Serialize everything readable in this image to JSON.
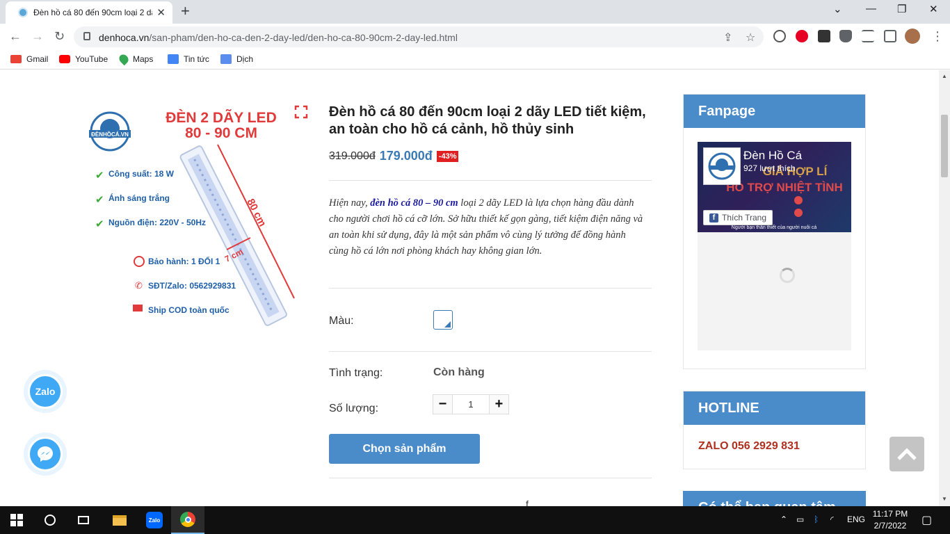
{
  "browser": {
    "tab_title": "Đèn hồ cá 80 đến 90cm loại 2 dã",
    "url_domain": "denhoca.vn",
    "url_path": "/san-pham/den-ho-ca-den-2-day-led/den-ho-ca-80-90cm-2-day-led.html",
    "bookmarks": [
      "Gmail",
      "YouTube",
      "Maps",
      "Tin tức",
      "Dịch"
    ]
  },
  "product": {
    "image_text": {
      "logo": "ĐÈNHỒCÁ.VN",
      "heading_1": "ĐÈN 2 DÃY LED",
      "heading_2": "80 - 90 CM",
      "feature_1": "Công suất: 18 W",
      "feature_2": "Ánh sáng trắng",
      "feature_3": "Nguồn điện: 220V - 50Hz",
      "length": "80 cm",
      "width": "7 cm",
      "warranty": "Bảo hành: 1 ĐỔI 1",
      "phone": "SĐT/Zalo: 0562929831",
      "ship": "Ship COD toàn quốc"
    },
    "title": "Đèn hồ cá 80 đến 90cm loại 2 dãy LED tiết kiệm, an toàn cho hồ cá cảnh, hồ thủy sinh",
    "old_price": "319.000đ",
    "new_price": "179.000đ",
    "discount": "-43%",
    "desc_before": "Hiện nay, ",
    "desc_highlight": "đèn hồ cá 80 – 90 cm",
    "desc_after": " loại 2 dãy LED là lựa chọn hàng đầu dành cho người chơi hồ cá cỡ lớn. Sở hữu thiết kế gọn gàng, tiết kiệm điện năng và an toàn khi sử dụng, đây là một sản phẩm vô cùng lý tưởng để đồng hành cùng hồ cá lớn nơi phòng khách hay không gian lớn.",
    "color_label": "Màu:",
    "status_label": "Tình trạng:",
    "status_value": "Còn hàng",
    "qty_label": "Số lượng:",
    "qty_value": "1",
    "buy_label": "Chọn sản phẩm",
    "tail_glyph": "f"
  },
  "sidebar": {
    "fanpage_title": "Fanpage",
    "fb_page_name": "Đèn Hồ Cá",
    "fb_likes": "927 lượt thích",
    "fb_like_button": "Thích Trang",
    "fb_banner_text": "GIÁ HỢP LÍ",
    "fb_banner_text2": "HỖ TRỢ NHIỆT TÌNH",
    "fb_banner_footer": "Người bạn thân thiết của người nuôi cá",
    "hotline_title": "HOTLINE",
    "hotline_value": "ZALO 056 2929 831",
    "maybe_title": "Có thể bạn quan tâm"
  },
  "floating": {
    "zalo_label": "Zalo"
  },
  "taskbar": {
    "lang": "ENG",
    "time": "11:17 PM",
    "date": "2/7/2022"
  },
  "colors": {
    "accent": "#4a8bc9",
    "price": "#3a7ab5",
    "discount": "#e02020",
    "hotline": "#b03020"
  }
}
